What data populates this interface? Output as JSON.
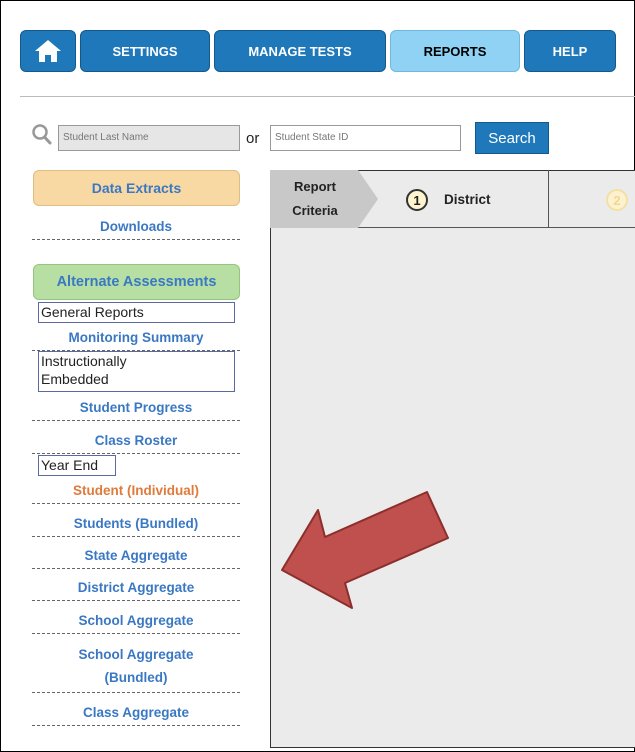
{
  "nav": {
    "home_icon": "home-icon",
    "items": [
      "SETTINGS",
      "MANAGE TESTS",
      "REPORTS",
      "HELP"
    ],
    "active": "REPORTS"
  },
  "search": {
    "last_name_placeholder": "Student Last Name",
    "or_label": "or",
    "state_id_placeholder": "Student State ID",
    "button_label": "Search"
  },
  "sidebar": {
    "data_extracts": "Data Extracts",
    "downloads": "Downloads",
    "alternate_assessments": "Alternate Assessments",
    "general_reports": "General Reports",
    "monitoring_summary": "Monitoring Summary",
    "instructionally_embedded": "Instructionally Embedded",
    "student_progress": "Student Progress",
    "class_roster": "Class Roster",
    "year_end": "Year End",
    "student_individual": "Student (Individual)",
    "students_bundled": "Students (Bundled)",
    "state_aggregate": "State Aggregate",
    "district_aggregate": "District Aggregate",
    "school_aggregate": "School Aggregate",
    "school_aggregate_bundled_1": "School Aggregate",
    "school_aggregate_bundled_2": "(Bundled)",
    "class_aggregate": "Class Aggregate"
  },
  "report": {
    "criteria_line1": "Report",
    "criteria_line2": "Criteria",
    "step1_num": "1",
    "step1_label": "District",
    "step2_num": "2"
  },
  "colors": {
    "nav_blue": "#1f78b9",
    "nav_active": "#8fd2f4",
    "link_blue": "#3a78c3",
    "highlight_orange": "#e07a3b",
    "annotation_arrow": "#c0504d"
  }
}
